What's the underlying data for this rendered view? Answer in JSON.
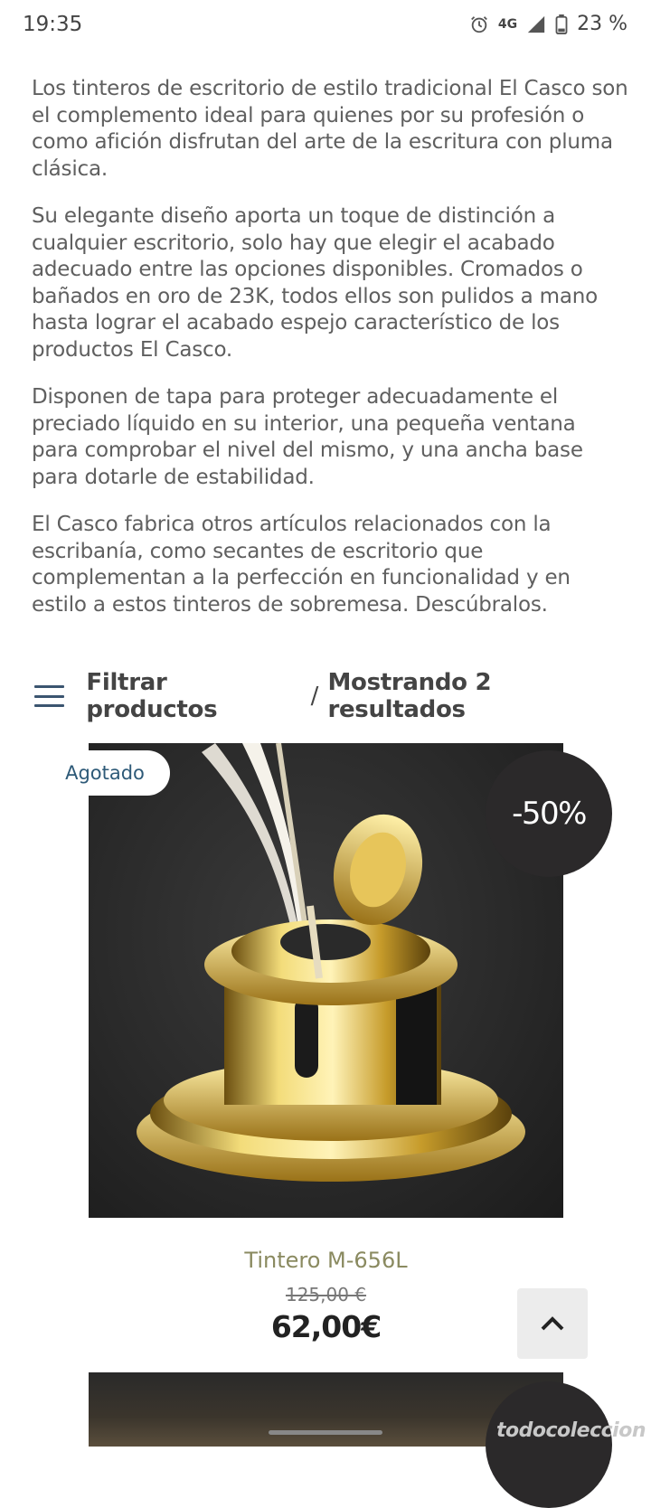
{
  "status_bar": {
    "time": "19:35",
    "network": "4G",
    "battery": "23 %"
  },
  "description": {
    "paragraphs": [
      "Los tinteros de escritorio de estilo tradicional El Casco son el complemento ideal para quienes por su profesión o como afición disfrutan del arte de la escritura con pluma clásica.",
      "Su elegante diseño aporta un toque de distinción a cualquier escritorio, solo hay que elegir el acabado adecuado entre las opciones disponibles. Cromados o bañados en oro de 23K, todos ellos son pulidos a mano hasta lograr el acabado espejo característico de los productos El Casco.",
      "Disponen de tapa para proteger adecuadamente el preciado líquido en su interior, una pequeña ventana para comprobar el nivel del mismo, y una ancha base para dotarle de estabilidad.",
      "El Casco fabrica otros artículos relacionados con la escribanía, como secantes de escritorio que complementan a la perfección en funcionalidad y en estilo a estos tinteros de sobremesa. Descúbralos."
    ]
  },
  "filter_bar": {
    "filter_label": "Filtrar productos",
    "separator": "/",
    "results_label": "Mostrando 2 resultados"
  },
  "products": [
    {
      "name": "Tintero M-656L",
      "old_price": "125,00 €",
      "price": "62,00€",
      "sold_badge": "Agotado",
      "discount_badge": "-50%"
    }
  ],
  "watermark": "todocoleccion",
  "colors": {
    "accent": "#3b5570",
    "badge_dark": "#2b292a",
    "product_name": "#8a8a60"
  }
}
